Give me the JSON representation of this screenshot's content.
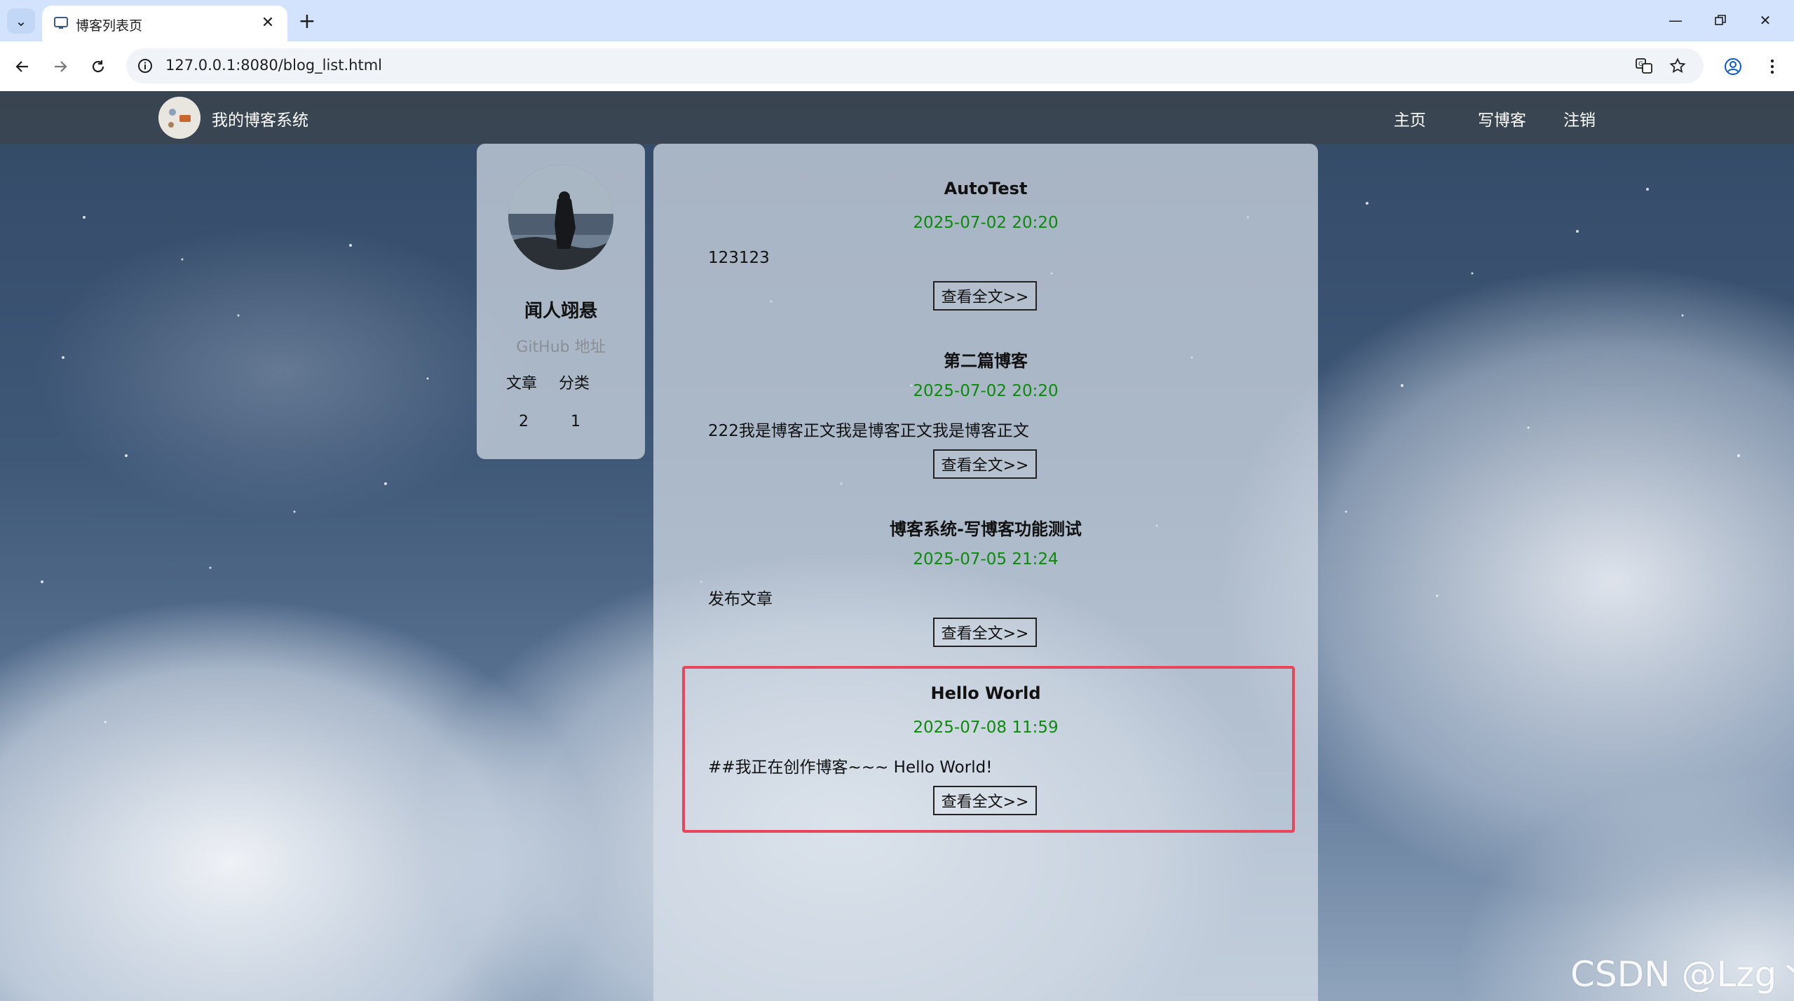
{
  "browser": {
    "tab_title": "博客列表页",
    "url": "127.0.0.1:8080/blog_list.html"
  },
  "site": {
    "title": "我的博客系统",
    "nav": [
      "主页",
      "写博客",
      "注销"
    ]
  },
  "profile": {
    "name": "闻人翊悬",
    "github_label": "GitHub 地址",
    "stats": [
      {
        "label": "文章",
        "value": "2"
      },
      {
        "label": "分类",
        "value": "1"
      }
    ]
  },
  "blogs": [
    {
      "title": "AutoTest",
      "date": "2025-07-02 20:20",
      "desc": "123123",
      "button": "查看全文>>"
    },
    {
      "title": "第二篇博客",
      "date": "2025-07-02 20:20",
      "desc": "222我是博客正文我是博客正文我是博客正文",
      "button": "查看全文>>"
    },
    {
      "title": "博客系统-写博客功能测试",
      "date": "2025-07-05 21:24",
      "desc": "发布文章",
      "button": "查看全文>>"
    },
    {
      "title": "Hello World",
      "date": "2025-07-08 11:59",
      "desc": "##我正在创作博客~~~ Hello World!",
      "button": "查看全文>>"
    }
  ],
  "watermark": "CSDN @Lzg丶",
  "colors": {
    "date_green": "#0b8a0b",
    "highlight_red": "#e8465a",
    "nav_bar": "#3c424a"
  }
}
